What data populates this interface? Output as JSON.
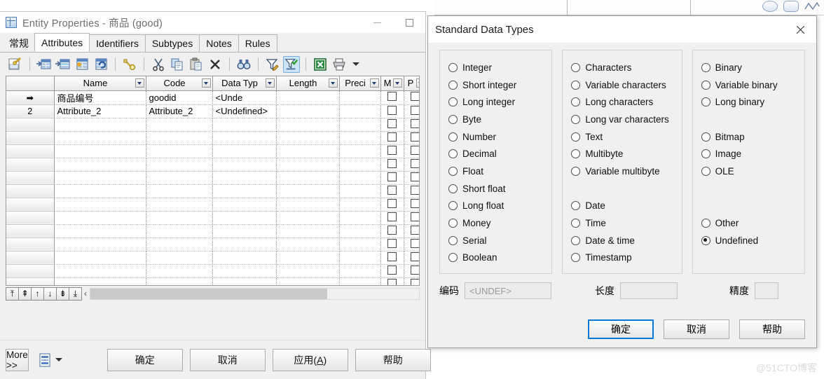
{
  "background_canvas": {
    "shapes": [
      {
        "name": "ellipse-shape-tool"
      },
      {
        "name": "rounded-rectangle-shape-tool"
      },
      {
        "name": "polyline-shape-tool"
      }
    ]
  },
  "main_window": {
    "icon": "table-grid-icon",
    "title": "Entity Properties - 商品 (good)",
    "controls": {
      "minimize": "minimize-icon",
      "maximize": "maximize-icon"
    },
    "tabs": [
      {
        "label": "常规",
        "active": false
      },
      {
        "label": "Attributes",
        "active": true
      },
      {
        "label": "Identifiers",
        "active": false
      },
      {
        "label": "Subtypes",
        "active": false
      },
      {
        "label": "Notes",
        "active": false
      },
      {
        "label": "Rules",
        "active": false
      }
    ],
    "toolbar": [
      {
        "name": "properties-icon",
        "selected": false
      },
      {
        "name": "insert-row-icon",
        "selected": false
      },
      {
        "name": "add-row-icon",
        "selected": false
      },
      {
        "name": "add-object-icon",
        "selected": false
      },
      {
        "name": "reuse-object-icon",
        "selected": false
      },
      {
        "name": "primary-key-icon",
        "selected": false
      },
      {
        "name": "cut-icon",
        "selected": false
      },
      {
        "name": "copy-icon",
        "selected": false
      },
      {
        "name": "paste-icon",
        "selected": false
      },
      {
        "name": "delete-icon",
        "selected": false
      },
      {
        "name": "find-icon",
        "selected": false
      },
      {
        "name": "edit-filter-icon",
        "selected": false
      },
      {
        "name": "apply-filter-icon",
        "selected": true
      },
      {
        "name": "export-excel-icon",
        "selected": false
      },
      {
        "name": "print-icon",
        "selected": false
      }
    ],
    "grid": {
      "columns": [
        "",
        "Name",
        "Code",
        "Data Typ",
        "Length",
        "Preci",
        "M",
        "P"
      ],
      "rows": [
        {
          "marker": "➡",
          "name": "商品编号",
          "code": "goodid",
          "data_type": "<Unde",
          "length": "",
          "precision": "",
          "m": false,
          "p": false
        },
        {
          "marker": "2",
          "name": "Attribute_2",
          "code": "Attribute_2",
          "data_type": "<Undefined>",
          "length": "",
          "precision": "",
          "m": false,
          "p": false
        }
      ],
      "empty_row_count": 13
    },
    "nav_buttons": [
      {
        "name": "go-first-icon",
        "glyph": "⤒"
      },
      {
        "name": "go-previous-page-icon",
        "glyph": "⇞"
      },
      {
        "name": "go-previous-icon",
        "glyph": "↑"
      },
      {
        "name": "go-next-icon",
        "glyph": "↓"
      },
      {
        "name": "go-next-page-icon",
        "glyph": "⇟"
      },
      {
        "name": "go-last-icon",
        "glyph": "⤓"
      }
    ],
    "scroll_left_glyph": "‹",
    "bottom_bar": {
      "more_label": "More >>",
      "report_icon": "report-icon",
      "dropdown_icon": "chevron-down-icon",
      "ok_label": "确定",
      "cancel_label": "取消",
      "apply_label": "应用(A)",
      "apply_accel": "A",
      "help_label": "帮助"
    }
  },
  "dialog": {
    "title": "Standard Data Types",
    "close_icon": "close-icon",
    "selected_value": "Undefined",
    "columns": [
      {
        "name": "numeric-types-group",
        "items": [
          {
            "label": "Integer",
            "selected": false
          },
          {
            "label": "Short integer",
            "selected": false
          },
          {
            "label": "Long integer",
            "selected": false
          },
          {
            "label": "Byte",
            "selected": false
          },
          {
            "label": "Number",
            "selected": false
          },
          {
            "label": "Decimal",
            "selected": false
          },
          {
            "label": "Float",
            "selected": false
          },
          {
            "label": "Short float",
            "selected": false
          },
          {
            "label": "Long float",
            "selected": false
          },
          {
            "label": "Money",
            "selected": false
          },
          {
            "label": "Serial",
            "selected": false
          },
          {
            "label": "Boolean",
            "selected": false
          }
        ]
      },
      {
        "name": "character-types-group",
        "items": [
          {
            "label": "Characters",
            "selected": false
          },
          {
            "label": "Variable characters",
            "selected": false
          },
          {
            "label": "Long characters",
            "selected": false
          },
          {
            "label": "Long var characters",
            "selected": false
          },
          {
            "label": "Text",
            "selected": false
          },
          {
            "label": "Multibyte",
            "selected": false
          },
          {
            "label": "Variable multibyte",
            "selected": false
          },
          {
            "spacer": true
          },
          {
            "label": "Date",
            "selected": false
          },
          {
            "label": "Time",
            "selected": false
          },
          {
            "label": "Date & time",
            "selected": false
          },
          {
            "label": "Timestamp",
            "selected": false
          }
        ]
      },
      {
        "name": "binary-other-types-group",
        "items": [
          {
            "label": "Binary",
            "selected": false
          },
          {
            "label": "Variable binary",
            "selected": false
          },
          {
            "label": "Long binary",
            "selected": false
          },
          {
            "spacer": true
          },
          {
            "label": "Bitmap",
            "selected": false
          },
          {
            "label": "Image",
            "selected": false
          },
          {
            "label": "OLE",
            "selected": false
          },
          {
            "spacer": true
          },
          {
            "spacer": true
          },
          {
            "label": "Other",
            "selected": false
          },
          {
            "label": "Undefined",
            "selected": true
          }
        ]
      }
    ],
    "fields": {
      "code_label": "编码",
      "code_value": "<UNDEF>",
      "length_label": "长度",
      "length_value": "",
      "precision_label": "精度",
      "precision_value": ""
    },
    "buttons": {
      "ok_label": "确定",
      "cancel_label": "取消",
      "help_label": "帮助"
    }
  },
  "watermark": "@51CTO博客"
}
